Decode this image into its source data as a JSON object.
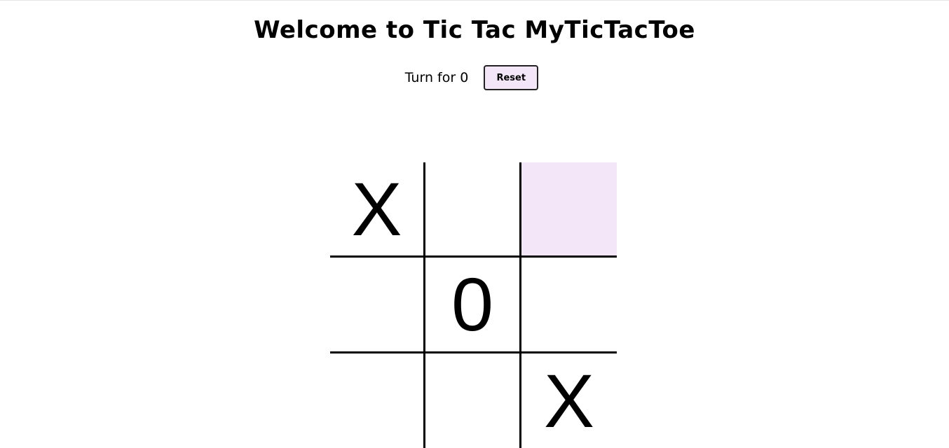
{
  "header": {
    "title": "Welcome to Tic Tac MyTicTacToe"
  },
  "status": {
    "turn_text": "Turn for 0",
    "reset_label": "Reset"
  },
  "board": {
    "cells": [
      "X",
      "",
      "",
      "",
      "0",
      "",
      "",
      "",
      "X"
    ],
    "highlighted_cell_index": 2,
    "highlight_color": "#f3e6f8"
  }
}
